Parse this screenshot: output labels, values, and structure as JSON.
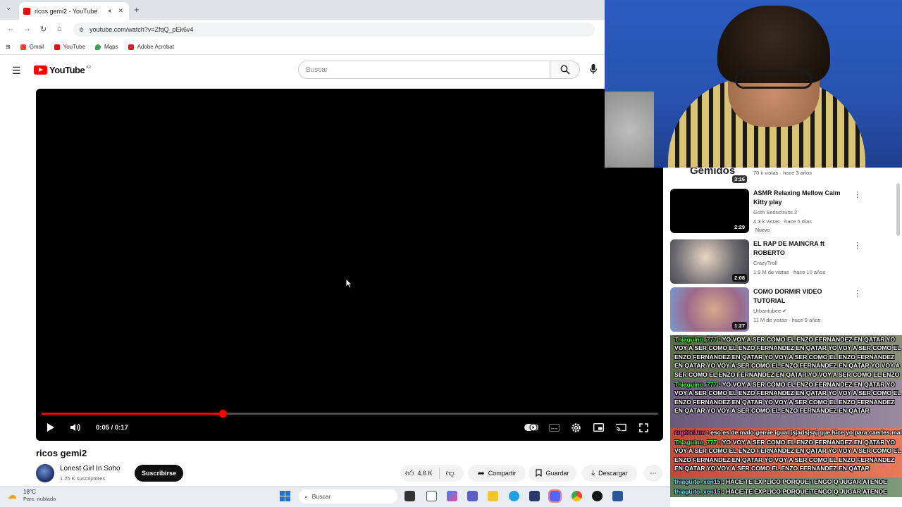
{
  "browser": {
    "tab_title": "ricos gemi2 - YouTube",
    "url": "youtube.com/watch?v=ZfqQ_pEk6v4",
    "bookmarks": [
      {
        "label": "Gmail",
        "color": "#ea4335"
      },
      {
        "label": "YouTube",
        "color": "#ff0000"
      },
      {
        "label": "Maps",
        "color": "#34a853"
      },
      {
        "label": "Adobe Acrobat",
        "color": "#d61f1f"
      }
    ]
  },
  "youtube": {
    "logo": "YouTube",
    "country": "AR",
    "search_placeholder": "Buscar"
  },
  "player": {
    "time": "0:05 / 0:17",
    "progress_fraction": 0.294
  },
  "video": {
    "title": "ricos gemi2",
    "channel": "Lonest Girl In Soho",
    "subscribers": "1.25 K suscriptores",
    "subscribe_label": "Suscribirse",
    "likes": "4.6 K",
    "share_label": "Compartir",
    "save_label": "Guardar",
    "download_label": "Descargar"
  },
  "sidebar": {
    "top_partial": {
      "title_fragment": "Gemidos",
      "duration": "3:16",
      "meta": "70 k vistas · hace 3 años"
    },
    "items": [
      {
        "title": "ASMR Relaxing Mellow Calm Kitty play",
        "channel": "Goth Seductruss 2",
        "meta": "4.3 k vistas · hace 5 días",
        "duration": "2:29",
        "badge": "Nuevo"
      },
      {
        "title": "EL RAP DE MAINCRA ft ROBERTO",
        "channel": "CrazyTroll",
        "meta": "1.9 M de vistas · hace 10 años",
        "duration": "2:08"
      },
      {
        "title": "COMO DORMIR VIDEO TUTORIAL",
        "channel": "Urbantubee",
        "meta": "11 M de vistas · hace 9 años",
        "duration": "1:27"
      }
    ]
  },
  "chat": [
    {
      "user": "Thiaguino_777",
      "msg": ": YO VOY A SER COMO EL ENZO FERNANDEZ EN QATAR YO VOY A SER COMO EL ENZO FERNANDEZ EN QATAR YO VOY A SER COMO EL ENZO FERNANDEZ EN QATAR YO VOY A SER COMO EL ENZO FERNANDEZ EN QATAR YO VOY A SER COMO EL ENZO FERNANDEZ EN QATAR YO VOY A SER COMO EL ENZO FERNANDEZ EN QATAR YO VOY A SER COMO EL ENZO FERNANDEZ EN QATAR",
      "style": "bg1"
    },
    {
      "user": "Thiaguino_777",
      "msg": ": YO VOY A SER COMO EL ENZO FERNANDEZ EN QATAR YO VOY A SER COMO EL ENZO FERNANDEZ EN QATAR YO VOY A SER COMO EL ENZO FERNANDEZ EN QATAR YO VOY A SER COMO EL ENZO FERNANDEZ EN QATAR YO VOY A SER COMO EL ENZO FERNANDEZ EN QATAR",
      "style": "bg2"
    },
    {
      "user": "cuptoclum",
      "msg": ": eso es de malo gemie igual jsjadsjsaj que hice yo para caerles mal",
      "style": "bg3 pink"
    },
    {
      "user": "Thiaguino_777",
      "msg": ": YO VOY A SER COMO EL ENZO FERNANDEZ EN QATAR YO VOY A SER COMO EL ENZO FERNANDEZ EN QATAR YO VOY A SER COMO EL ENZO FERNANDEZ EN QATAR YO VOY A SER COMO EL ENZO FERNANDEZ EN QATAR YO VOY A SER COMO EL ENZO FERNANDEZ EN QATAR",
      "style": "bg3"
    },
    {
      "user": "thiaguito_xen15",
      "msg": ": HACE TE EXPLICO PORQUE TENGO Q JUGAR ATENDE",
      "style": "bg4 cyan"
    },
    {
      "user": "thiaguito_xen15",
      "msg": ": HACE TE EXPLICO PORQUE TENGO Q JUGAR ATENDE",
      "style": "bg4 cyan"
    }
  ],
  "taskbar": {
    "temperature": "18°C",
    "weather": "Parc. nublado",
    "search": "Buscar"
  }
}
